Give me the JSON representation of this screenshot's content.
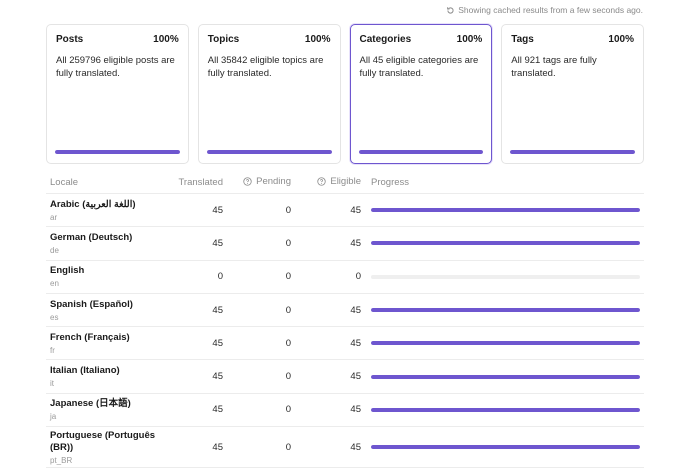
{
  "cache_note": "Showing cached results from a few seconds ago.",
  "accent_color": "#6e56cf",
  "cards": [
    {
      "title": "Posts",
      "percent": "100%",
      "description": "All 259796 eligible posts are fully translated.",
      "progress": 1.0,
      "selected": false
    },
    {
      "title": "Topics",
      "percent": "100%",
      "description": "All 35842 eligible topics are fully translated.",
      "progress": 1.0,
      "selected": false
    },
    {
      "title": "Categories",
      "percent": "100%",
      "description": "All 45 eligible categories are fully translated.",
      "progress": 1.0,
      "selected": true
    },
    {
      "title": "Tags",
      "percent": "100%",
      "description": "All 921 tags are fully translated.",
      "progress": 1.0,
      "selected": false
    }
  ],
  "table": {
    "headers": {
      "locale": "Locale",
      "translated": "Translated",
      "pending": "Pending",
      "eligible": "Eligible",
      "progress": "Progress"
    },
    "rows": [
      {
        "name": "Arabic (اللغة العربية)",
        "code": "ar",
        "translated": "45",
        "pending": "0",
        "eligible": "45",
        "progress": 1.0
      },
      {
        "name": "German (Deutsch)",
        "code": "de",
        "translated": "45",
        "pending": "0",
        "eligible": "45",
        "progress": 1.0
      },
      {
        "name": "English",
        "code": "en",
        "translated": "0",
        "pending": "0",
        "eligible": "0",
        "progress": 0.0
      },
      {
        "name": "Spanish (Español)",
        "code": "es",
        "translated": "45",
        "pending": "0",
        "eligible": "45",
        "progress": 1.0
      },
      {
        "name": "French (Français)",
        "code": "fr",
        "translated": "45",
        "pending": "0",
        "eligible": "45",
        "progress": 1.0
      },
      {
        "name": "Italian (Italiano)",
        "code": "it",
        "translated": "45",
        "pending": "0",
        "eligible": "45",
        "progress": 1.0
      },
      {
        "name": "Japanese (日本語)",
        "code": "ja",
        "translated": "45",
        "pending": "0",
        "eligible": "45",
        "progress": 1.0
      },
      {
        "name": "Portuguese (Português (BR))",
        "code": "pt_BR",
        "translated": "45",
        "pending": "0",
        "eligible": "45",
        "progress": 1.0
      }
    ]
  }
}
